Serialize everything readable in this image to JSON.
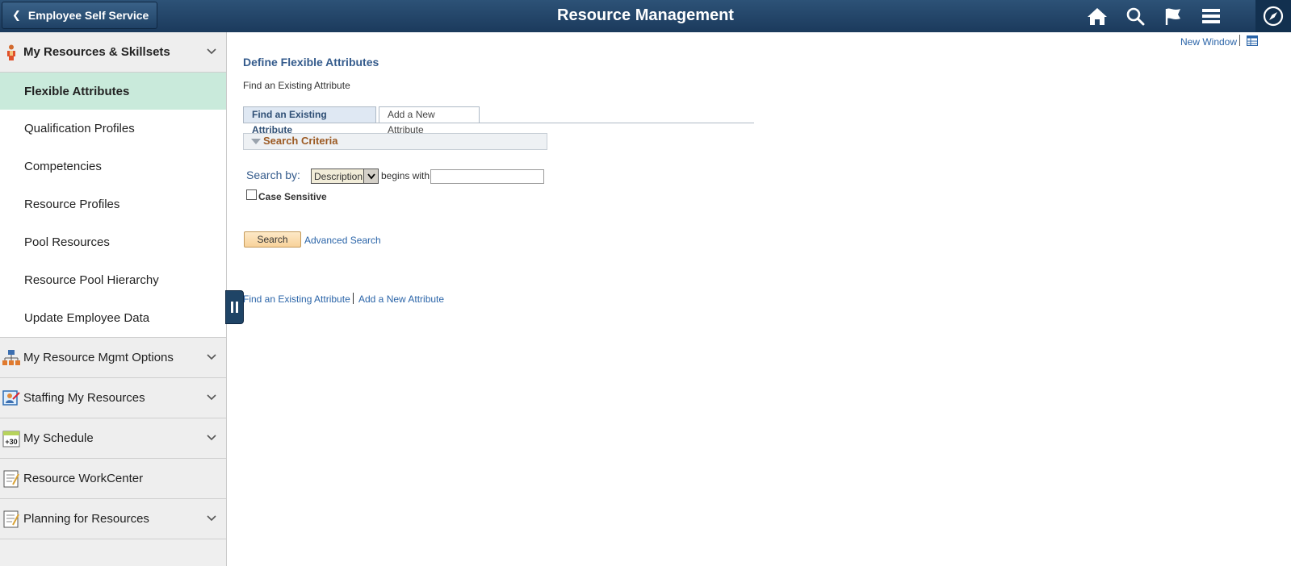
{
  "header": {
    "back_label": "Employee Self Service",
    "title": "Resource Management",
    "icons": [
      "home-icon",
      "search-icon",
      "flag-icon",
      "menu-icon",
      "navbar-compass-icon"
    ]
  },
  "sidebar": {
    "sections": [
      {
        "label": "My Resources & Skillsets",
        "icon": "person-icon",
        "expanded": true,
        "items": [
          {
            "label": "Flexible Attributes",
            "active": true
          },
          {
            "label": "Qualification Profiles"
          },
          {
            "label": "Competencies"
          },
          {
            "label": "Resource Profiles"
          },
          {
            "label": "Pool Resources"
          },
          {
            "label": "Resource Pool Hierarchy"
          },
          {
            "label": "Update Employee Data"
          }
        ]
      },
      {
        "label": "My Resource Mgmt Options",
        "icon": "org-chart-icon",
        "chevron": true
      },
      {
        "label": "Staffing My Resources",
        "icon": "staffing-icon",
        "chevron": true
      },
      {
        "label": "My Schedule",
        "icon": "calendar-plus30-icon",
        "badge": "+30",
        "chevron": true
      },
      {
        "label": "Resource WorkCenter",
        "icon": "notepad-icon",
        "chevron": false
      },
      {
        "label": "Planning for Resources",
        "icon": "notepad-icon",
        "chevron": true
      }
    ]
  },
  "main": {
    "new_window": "New Window",
    "heading": "Define Flexible Attributes",
    "subheading": "Find an Existing Attribute",
    "tabs": [
      {
        "label": "Find an Existing Attribute",
        "active": true
      },
      {
        "label": "Add a New Attribute",
        "active": false
      }
    ],
    "criteria_label": "Search Criteria",
    "search_by_label": "Search by:",
    "search_by_value": "Description",
    "operator_label": "begins with",
    "search_value": "",
    "case_sensitive_label": "Case Sensitive",
    "case_sensitive_checked": false,
    "search_button": "Search",
    "advanced_search": "Advanced Search",
    "footer_links": [
      "Find an Existing Attribute",
      "Add a New Attribute"
    ]
  },
  "colors": {
    "header_bg": "#1f4165",
    "active_item_bg": "#c9eadb",
    "link": "#2a64a8",
    "heading": "#345b8c",
    "criteria_text": "#9c5a23"
  }
}
